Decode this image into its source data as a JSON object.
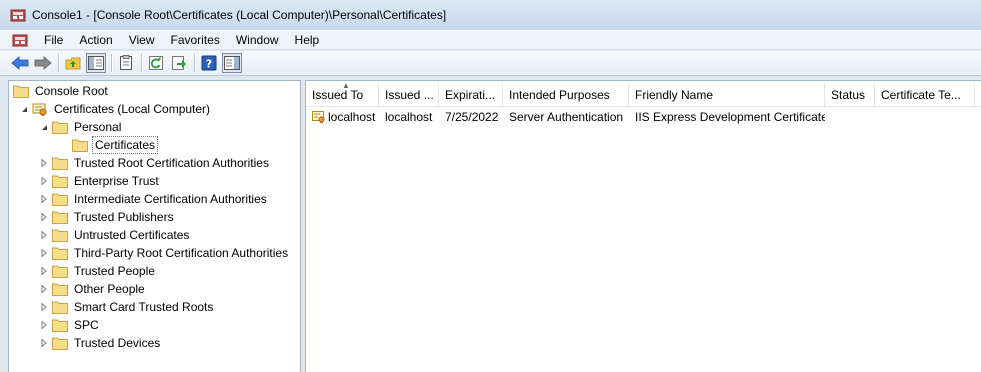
{
  "window": {
    "title": "Console1 - [Console Root\\Certificates (Local Computer)\\Personal\\Certificates]"
  },
  "menu": [
    "File",
    "Action",
    "View",
    "Favorites",
    "Window",
    "Help"
  ],
  "toolbar": {
    "buttons": [
      "back-arrow-icon",
      "forward-arrow-icon",
      "up-folder-icon",
      "show-hide-tree-icon",
      "export-list-icon",
      "refresh-icon",
      "export-icon",
      "help-icon",
      "action-pane-icon"
    ]
  },
  "tree": {
    "root": "Console Root",
    "snapin": "Certificates (Local Computer)",
    "personal": "Personal",
    "certificates": "Certificates",
    "stores": [
      "Trusted Root Certification Authorities",
      "Enterprise Trust",
      "Intermediate Certification Authorities",
      "Trusted Publishers",
      "Untrusted Certificates",
      "Third-Party Root Certification Authorities",
      "Trusted People",
      "Other People",
      "Smart Card Trusted Roots",
      "SPC",
      "Trusted Devices"
    ]
  },
  "list": {
    "columns": [
      "Issued To",
      "Issued ...",
      "Expirati...",
      "Intended Purposes",
      "Friendly Name",
      "Status",
      "Certificate Te..."
    ],
    "rows": [
      [
        "localhost",
        "localhost",
        "7/25/2022",
        "Server Authentication",
        "IIS Express Development Certificate",
        "",
        ""
      ]
    ]
  }
}
